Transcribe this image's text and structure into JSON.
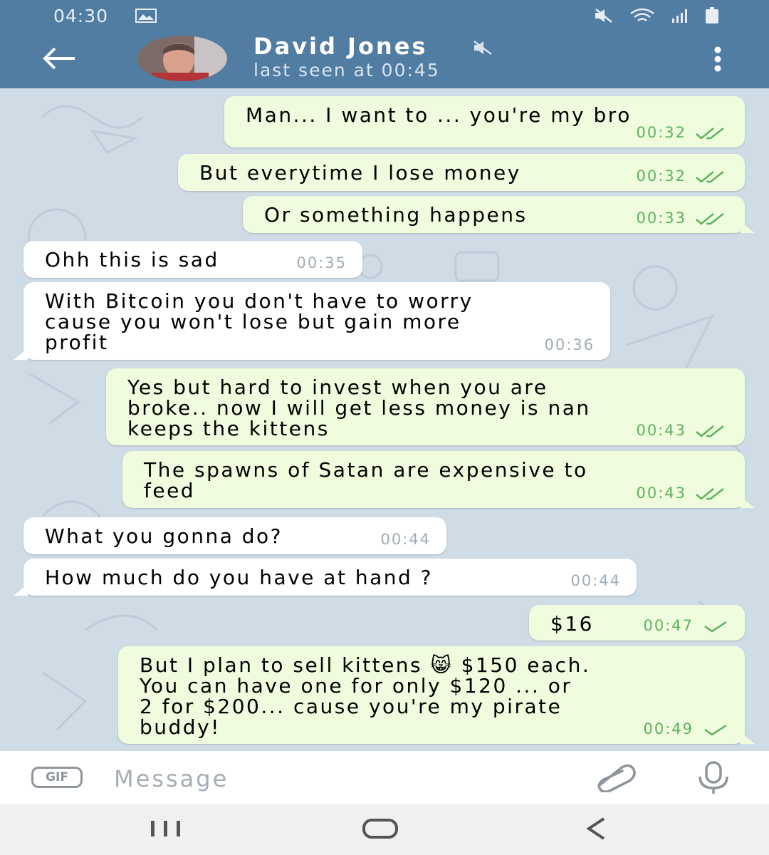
{
  "status_bar": {
    "time": "04:30"
  },
  "header": {
    "contact_name": "David Jones",
    "last_seen": "last seen at 00:45"
  },
  "messages": [
    {
      "side": "out",
      "text": "Man... I want to ... you're my bro",
      "time": "00:32",
      "status": "read"
    },
    {
      "side": "out",
      "text": "But everytime I lose money",
      "time": "00:32",
      "status": "read"
    },
    {
      "side": "out",
      "text": "Or something happens",
      "time": "00:33",
      "status": "read"
    },
    {
      "side": "in",
      "text": "Ohh this is sad",
      "time": "00:35"
    },
    {
      "side": "in",
      "text": "With Bitcoin you don't have to worry\ncause you won't lose but gain more\nprofit",
      "time": "00:36"
    },
    {
      "side": "out",
      "text": "Yes but hard to invest when you are\nbroke.. now I will get less money is nan\nkeeps the kittens",
      "time": "00:43",
      "status": "read"
    },
    {
      "side": "out",
      "text": "The spawns of Satan are expensive to\nfeed",
      "time": "00:43",
      "status": "read"
    },
    {
      "side": "in",
      "text": "What you gonna do?",
      "time": "00:44"
    },
    {
      "side": "in",
      "text": "How much do you have at hand ?",
      "time": "00:44"
    },
    {
      "side": "out",
      "text": "$16",
      "time": "00:47",
      "status": "sent"
    },
    {
      "side": "out",
      "text": "But I plan to sell kittens 😸 $150 each.\nYou can have one for only $120 ... or\n2 for $200... cause you're my pirate\nbuddy!",
      "time": "00:49",
      "status": "sent"
    }
  ],
  "input": {
    "gif_label": "GIF",
    "placeholder": "Message"
  },
  "icons": {
    "back": "back-arrow-icon",
    "menu": "more-vertical-icon",
    "mute": "muted-icon",
    "attach": "paperclip-icon",
    "mic": "microphone-icon"
  },
  "colors": {
    "header": "#517da2",
    "chat_background": "#cfdbe5",
    "outgoing_bubble": "#effdde",
    "incoming_bubble": "#ffffff",
    "check_green": "#5fb15f"
  }
}
